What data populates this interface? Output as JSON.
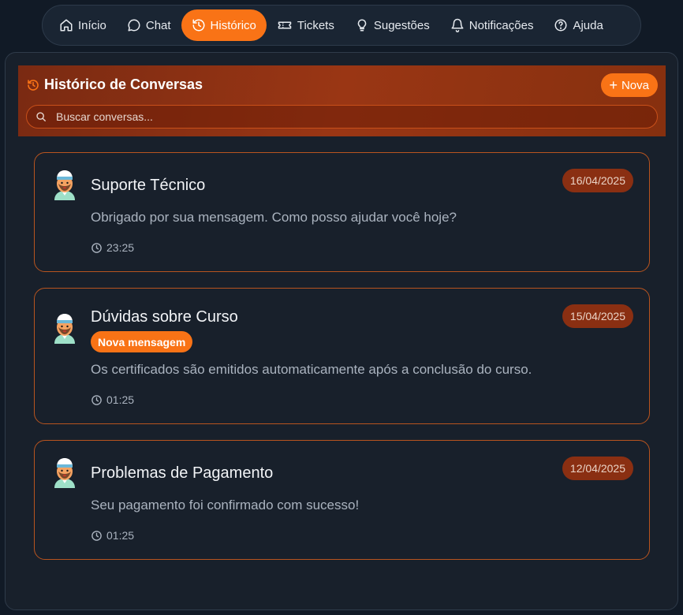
{
  "nav": {
    "items": [
      {
        "label": "Início",
        "icon": "home-icon"
      },
      {
        "label": "Chat",
        "icon": "chat-bubble-icon"
      },
      {
        "label": "Histórico",
        "icon": "history-icon",
        "active": true
      },
      {
        "label": "Tickets",
        "icon": "ticket-icon"
      },
      {
        "label": "Sugestões",
        "icon": "lightbulb-icon"
      },
      {
        "label": "Notificações",
        "icon": "bell-icon"
      },
      {
        "label": "Ajuda",
        "icon": "help-circle-icon"
      }
    ]
  },
  "header": {
    "title": "Histórico de Conversas",
    "new_label": "Nova",
    "search_placeholder": "Buscar conversas..."
  },
  "conversations": [
    {
      "title": "Suporte Técnico",
      "date": "16/04/2025",
      "badge": "",
      "message": "Obrigado por sua mensagem. Como posso ajudar você hoje?",
      "time": "23:25"
    },
    {
      "title": "Dúvidas sobre Curso",
      "date": "15/04/2025",
      "badge": "Nova mensagem",
      "message": "Os certificados são emitidos automaticamente após a conclusão do curso.",
      "time": "01:25"
    },
    {
      "title": "Problemas de Pagamento",
      "date": "12/04/2025",
      "badge": "",
      "message": "Seu pagamento foi confirmado com sucesso!",
      "time": "01:25"
    }
  ],
  "colors": {
    "accent": "#f97316",
    "header_bg": "#8a2f12",
    "card_border": "#b8541f",
    "panel_bg": "#18202b"
  }
}
